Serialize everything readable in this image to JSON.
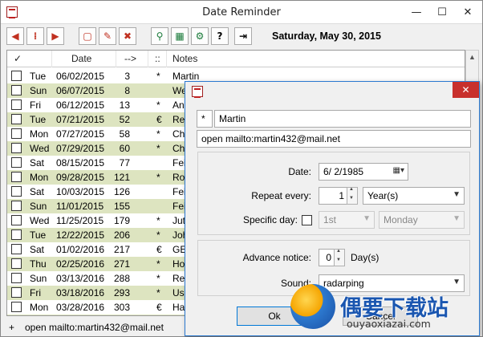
{
  "window": {
    "title": "Date Reminder",
    "minimize": "—",
    "maximize": "☐",
    "close": "✕"
  },
  "toolbar": {
    "buttons": [
      {
        "name": "prev-button",
        "glyph": "◀",
        "color": "#c03020"
      },
      {
        "name": "today-button",
        "glyph": "⁞",
        "color": "#c03020"
      },
      {
        "name": "next-button",
        "glyph": "▶",
        "color": "#c03020"
      },
      {
        "name": "new-button",
        "glyph": "▢",
        "color": "#c03020"
      },
      {
        "name": "edit-button",
        "glyph": "✎",
        "color": "#c03020"
      },
      {
        "name": "delete-button",
        "glyph": "✖",
        "color": "#c03020"
      },
      {
        "name": "search-button",
        "glyph": "⚲",
        "color": "#1a7a3a"
      },
      {
        "name": "calendar-button",
        "glyph": "▦",
        "color": "#1a7a3a"
      },
      {
        "name": "settings-button",
        "glyph": "⚙",
        "color": "#1a7a3a"
      },
      {
        "name": "help-button",
        "glyph": "?",
        "color": "#000000"
      },
      {
        "name": "exit-button",
        "glyph": "⇥",
        "color": "#000000"
      }
    ],
    "current_date": "Saturday, May 30, 2015"
  },
  "list": {
    "headers": {
      "check": "✓",
      "date": "Date",
      "days": "-->",
      "flag": "::",
      "notes": "Notes"
    },
    "rows": [
      {
        "dow": "Tue",
        "date": "06/02/2015",
        "days": "3",
        "flag": "*",
        "note": "Martin"
      },
      {
        "dow": "Sun",
        "date": "06/07/2015",
        "days": "8",
        "flag": "",
        "note": "We"
      },
      {
        "dow": "Fri",
        "date": "06/12/2015",
        "days": "13",
        "flag": "*",
        "note": "Ann"
      },
      {
        "dow": "Tue",
        "date": "07/21/2015",
        "days": "52",
        "flag": "€",
        "note": "Rec"
      },
      {
        "dow": "Mon",
        "date": "07/27/2015",
        "days": "58",
        "flag": "*",
        "note": "Ch"
      },
      {
        "dow": "Wed",
        "date": "07/29/2015",
        "days": "60",
        "flag": "*",
        "note": "Ch"
      },
      {
        "dow": "Sat",
        "date": "08/15/2015",
        "days": "77",
        "flag": "",
        "note": "Fei"
      },
      {
        "dow": "Mon",
        "date": "09/28/2015",
        "days": "121",
        "flag": "*",
        "note": "Rol"
      },
      {
        "dow": "Sat",
        "date": "10/03/2015",
        "days": "126",
        "flag": "",
        "note": "Fei"
      },
      {
        "dow": "Sun",
        "date": "11/01/2015",
        "days": "155",
        "flag": "",
        "note": "Fei"
      },
      {
        "dow": "Wed",
        "date": "11/25/2015",
        "days": "179",
        "flag": "*",
        "note": "Jut"
      },
      {
        "dow": "Tue",
        "date": "12/22/2015",
        "days": "206",
        "flag": "*",
        "note": "Joh"
      },
      {
        "dow": "Sat",
        "date": "01/02/2016",
        "days": "217",
        "flag": "€",
        "note": "GE"
      },
      {
        "dow": "Thu",
        "date": "02/25/2016",
        "days": "271",
        "flag": "*",
        "note": "Hos"
      },
      {
        "dow": "Sun",
        "date": "03/13/2016",
        "days": "288",
        "flag": "*",
        "note": "Ren"
      },
      {
        "dow": "Fri",
        "date": "03/18/2016",
        "days": "293",
        "flag": "*",
        "note": "Use"
      },
      {
        "dow": "Mon",
        "date": "03/28/2016",
        "days": "303",
        "flag": "€",
        "note": "Hat"
      },
      {
        "dow": "Sun",
        "date": "04/17/2016",
        "days": "323",
        "flag": "*",
        "note": "Hei"
      }
    ]
  },
  "statusbar": {
    "plus": "+",
    "text": "open mailto:martin432@mail.net"
  },
  "dialog": {
    "flag_value": "*",
    "name_value": "Martin",
    "action_value": "open mailto:martin432@mail.net",
    "date_label": "Date:",
    "date_value": "6/  2/1985",
    "repeat_label": "Repeat every:",
    "repeat_value": "1",
    "repeat_unit": "Year(s)",
    "specific_label": "Specific day:",
    "specific_ordinal": "1st",
    "specific_weekday": "Monday",
    "advance_label": "Advance notice:",
    "advance_value": "0",
    "advance_unit": "Day(s)",
    "sound_label": "Sound:",
    "sound_value": "radarping",
    "ok_label": "Ok",
    "cancel_label": "Cancel",
    "close": "✕"
  },
  "watermark": {
    "brand": "偶要下载站",
    "url": "ouyaoxiazai.com"
  }
}
